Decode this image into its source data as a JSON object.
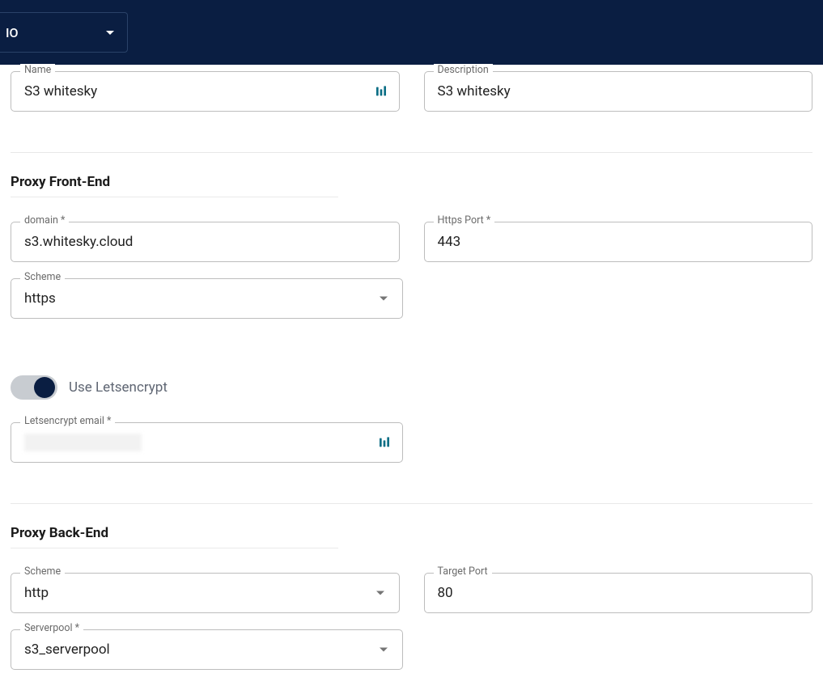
{
  "topbar": {
    "dropdown_label": "IO"
  },
  "general": {
    "name_label": "Name",
    "name_value": "S3 whitesky",
    "description_label": "Description",
    "description_value": "S3 whitesky"
  },
  "frontend": {
    "title": "Proxy Front-End",
    "domain_label": "domain *",
    "domain_value": "s3.whitesky.cloud",
    "https_port_label": "Https Port *",
    "https_port_value": "443",
    "scheme_label": "Scheme",
    "scheme_value": "https",
    "letsencrypt_toggle_label": "Use Letsencrypt",
    "letsencrypt_email_label": "Letsencrypt email *",
    "letsencrypt_email_value": ""
  },
  "backend": {
    "title": "Proxy Back-End",
    "scheme_label": "Scheme",
    "scheme_value": "http",
    "target_port_label": "Target Port",
    "target_port_value": "80",
    "serverpool_label": "Serverpool *",
    "serverpool_value": "s3_serverpool"
  }
}
